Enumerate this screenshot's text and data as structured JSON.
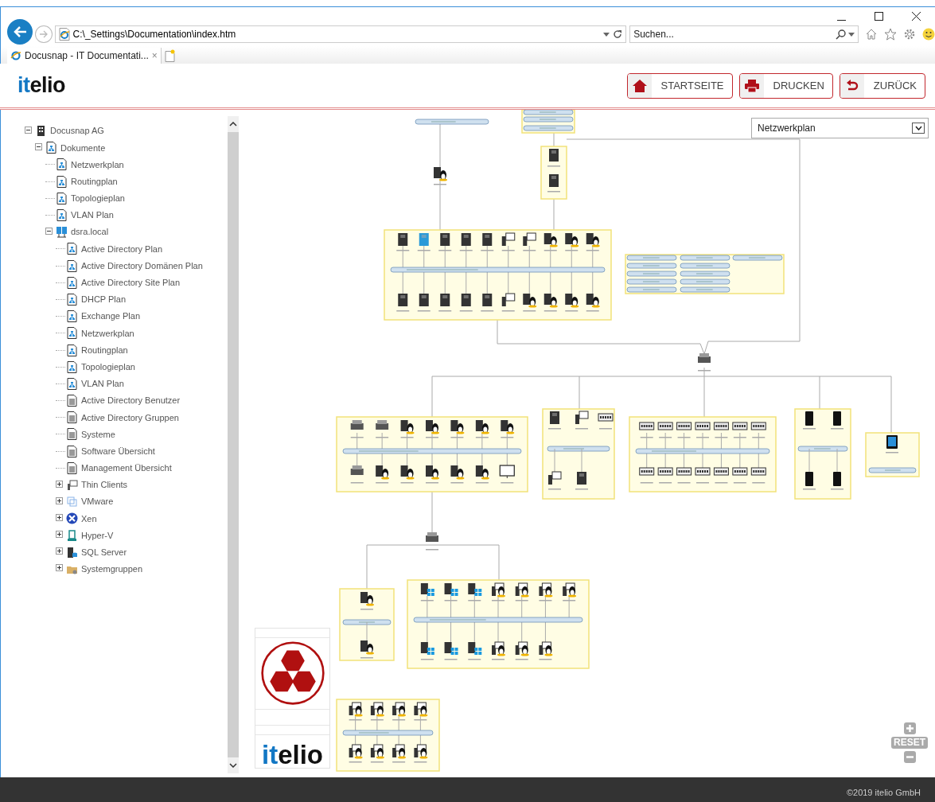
{
  "browser": {
    "address": "C:\\_Settings\\Documentation\\index.htm",
    "search_placeholder": "Suchen...",
    "tab": {
      "title": "Docusnap - IT Documentati...",
      "close": "×"
    }
  },
  "header": {
    "logo": [
      "it",
      "elio"
    ],
    "buttons": [
      {
        "label": "STARTSEITE"
      },
      {
        "label": "DRUCKEN"
      },
      {
        "label": "ZURÜCK"
      }
    ]
  },
  "tree": [
    {
      "label": "Docusnap AG",
      "kind": "company",
      "expanded": true,
      "children": [
        {
          "label": "Dokumente",
          "kind": "plan",
          "expanded": true,
          "children": [
            {
              "label": "Netzwerkplan",
              "kind": "plan"
            },
            {
              "label": "Routingplan",
              "kind": "plan"
            },
            {
              "label": "Topologieplan",
              "kind": "plan"
            },
            {
              "label": "VLAN Plan",
              "kind": "plan"
            },
            {
              "label": "dsra.local",
              "kind": "domain",
              "expanded": true,
              "children": [
                {
                  "label": "Active Directory Plan",
                  "kind": "plan"
                },
                {
                  "label": "Active Directory Domänen Plan",
                  "kind": "plan"
                },
                {
                  "label": "Active Directory Site Plan",
                  "kind": "plan"
                },
                {
                  "label": "DHCP Plan",
                  "kind": "plan"
                },
                {
                  "label": "Exchange Plan",
                  "kind": "plan"
                },
                {
                  "label": "Netzwerkplan",
                  "kind": "plan"
                },
                {
                  "label": "Routingplan",
                  "kind": "plan"
                },
                {
                  "label": "Topologieplan",
                  "kind": "plan"
                },
                {
                  "label": "VLAN Plan",
                  "kind": "plan"
                },
                {
                  "label": "Active Directory Benutzer",
                  "kind": "doc"
                },
                {
                  "label": "Active Directory Gruppen",
                  "kind": "doc"
                },
                {
                  "label": "Systeme",
                  "kind": "doc"
                },
                {
                  "label": "Software Übersicht",
                  "kind": "doc"
                },
                {
                  "label": "Management Übersicht",
                  "kind": "doc"
                },
                {
                  "label": "Thin Clients",
                  "kind": "thin",
                  "expanded": false
                },
                {
                  "label": "VMware",
                  "kind": "vmware",
                  "expanded": false
                },
                {
                  "label": "Xen",
                  "kind": "xen",
                  "expanded": false
                },
                {
                  "label": "Hyper-V",
                  "kind": "hyperv",
                  "expanded": false
                },
                {
                  "label": "SQL Server",
                  "kind": "sql",
                  "expanded": false
                },
                {
                  "label": "Systemgruppen",
                  "kind": "group",
                  "expanded": false
                }
              ]
            }
          ]
        }
      ]
    }
  ],
  "diagram": {
    "plan_select": "Netzwerkplan",
    "logo": [
      "it",
      "elio"
    ],
    "zoom_reset": "RESET"
  },
  "footer": "©2019 itelio GmbH"
}
